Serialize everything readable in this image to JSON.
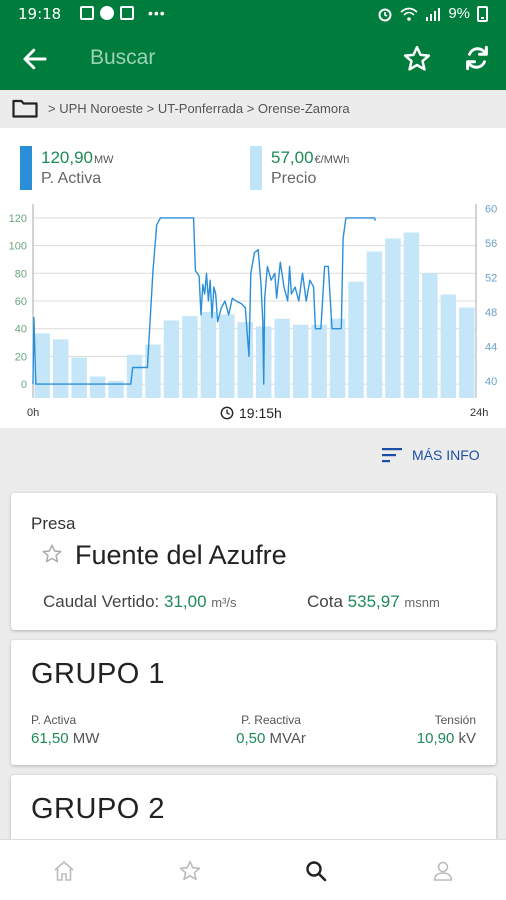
{
  "status_bar": {
    "time": "19:18",
    "battery": "9%",
    "icons": [
      "image-icon",
      "facebook-icon",
      "photo-edit-icon",
      "more-dots-icon",
      "alarm-icon",
      "wifi-icon",
      "signal-icon",
      "battery-icon"
    ]
  },
  "app_bar": {
    "title": "Buscar",
    "icons": [
      "back-arrow-icon",
      "star-outline-icon",
      "refresh-icon"
    ],
    "colors": {
      "background": "#007c3c",
      "title": "#9ed2b4"
    }
  },
  "breadcrumb": {
    "path": "> UPH Noroeste > UT-Ponferrada > Orense-Zamora",
    "icon": "folder-icon"
  },
  "legend": {
    "active_value": "120,90",
    "active_unit": "MW",
    "active_label": "P. Activa",
    "price_value": "57,00",
    "price_unit": "€/MWh",
    "price_label": "Precio",
    "colors": {
      "active": "#2a8fd8",
      "price": "#bfe3f7"
    }
  },
  "chart_data": {
    "type": "bar+line",
    "x_start_label": "0h",
    "x_end_label": "24h",
    "current_time": "19:15h",
    "left_axis": {
      "ticks": [
        0,
        20,
        40,
        60,
        80,
        100,
        120
      ],
      "range": [
        -10,
        130
      ]
    },
    "right_axis": {
      "ticks": [
        40,
        44,
        48,
        52,
        56,
        60
      ],
      "range": [
        38,
        60.5
      ]
    },
    "price_bars": {
      "name": "Precio",
      "hours": [
        0,
        1,
        2,
        3,
        4,
        5,
        6,
        7,
        8,
        9,
        10,
        11,
        12,
        13,
        14,
        15,
        16,
        17,
        18,
        19,
        20,
        21,
        22,
        23
      ],
      "values": [
        45.5,
        44.8,
        42.7,
        40.5,
        40.0,
        43.0,
        44.2,
        47.0,
        47.5,
        48.0,
        47.7,
        46.8,
        46.3,
        47.2,
        46.5,
        46.5,
        47.2,
        51.5,
        55.0,
        56.5,
        57.2,
        52.5,
        50.0,
        48.5
      ]
    },
    "power_line": {
      "name": "P. Activa",
      "points": [
        [
          0,
          0
        ],
        [
          0.05,
          48
        ],
        [
          0.15,
          0
        ],
        [
          5.3,
          0
        ],
        [
          5.4,
          12
        ],
        [
          6.2,
          12
        ],
        [
          6.5,
          82
        ],
        [
          6.7,
          115
        ],
        [
          6.9,
          120
        ],
        [
          8.7,
          120
        ],
        [
          8.8,
          82
        ],
        [
          9.0,
          78
        ],
        [
          9.1,
          50
        ],
        [
          9.2,
          72
        ],
        [
          9.3,
          65
        ],
        [
          9.4,
          80
        ],
        [
          9.5,
          60
        ],
        [
          9.6,
          75
        ],
        [
          9.7,
          48
        ],
        [
          9.8,
          70
        ],
        [
          9.9,
          65
        ],
        [
          10.0,
          45
        ],
        [
          10.2,
          55
        ],
        [
          10.4,
          60
        ],
        [
          10.6,
          50
        ],
        [
          10.8,
          62
        ],
        [
          11.0,
          60
        ],
        [
          11.3,
          58
        ],
        [
          11.5,
          55
        ],
        [
          11.7,
          20
        ],
        [
          11.8,
          80
        ],
        [
          12.0,
          95
        ],
        [
          12.2,
          97
        ],
        [
          12.35,
          72
        ],
        [
          12.45,
          45
        ],
        [
          12.5,
          0
        ],
        [
          12.55,
          62
        ],
        [
          12.7,
          85
        ],
        [
          12.9,
          75
        ],
        [
          13.1,
          80
        ],
        [
          13.2,
          62
        ],
        [
          13.4,
          88
        ],
        [
          13.6,
          70
        ],
        [
          13.8,
          60
        ],
        [
          13.9,
          85
        ],
        [
          14.0,
          65
        ],
        [
          14.2,
          70
        ],
        [
          14.4,
          60
        ],
        [
          14.6,
          80
        ],
        [
          14.8,
          60
        ],
        [
          15.0,
          75
        ],
        [
          15.2,
          70
        ],
        [
          15.3,
          40
        ],
        [
          15.6,
          40
        ],
        [
          15.8,
          85
        ],
        [
          16.0,
          85
        ],
        [
          16.2,
          40
        ],
        [
          16.7,
          40
        ],
        [
          16.8,
          105
        ],
        [
          16.95,
          120
        ],
        [
          18.5,
          120
        ],
        [
          18.55,
          118
        ]
      ]
    }
  },
  "more_info": {
    "label": "MÁS INFO",
    "icon": "sort-lines-icon"
  },
  "dam_card": {
    "kind": "Presa",
    "name": "Fuente del Azufre",
    "caudal_label": "Caudal Vertido:",
    "caudal_value": "31,00",
    "caudal_unit": "m³/s",
    "cota_label": "Cota",
    "cota_value": "535,97",
    "cota_unit": "msnm"
  },
  "group1": {
    "name": "GRUPO 1",
    "p_activa_label": "P. Activa",
    "p_activa_value": "61,50",
    "p_activa_unit": "MW",
    "p_reactiva_label": "P. Reactiva",
    "p_reactiva_value": "0,50",
    "p_reactiva_unit": "MVAr",
    "tension_label": "Tensión",
    "tension_value": "10,90",
    "tension_unit": "kV"
  },
  "group2": {
    "name": "GRUPO 2"
  },
  "bottom_nav": {
    "items": [
      "home-icon",
      "favorites-icon",
      "search-icon",
      "profile-icon"
    ],
    "active": "search-icon"
  }
}
